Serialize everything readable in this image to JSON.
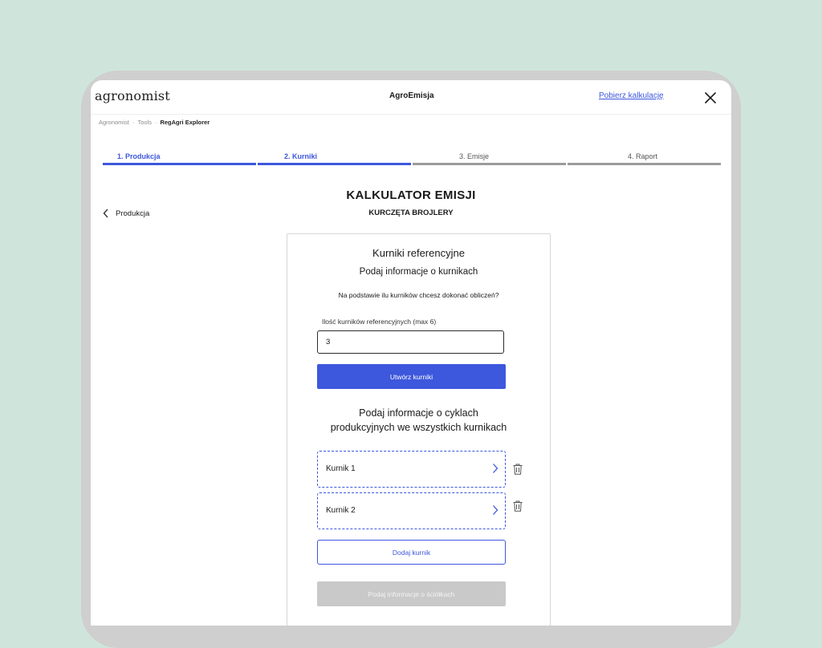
{
  "header": {
    "logo": "agronomist",
    "app_title": "AgroEmisja",
    "download_link": "Pobierz kalkulację"
  },
  "breadcrumb": [
    "Agronomist",
    "Tools",
    "RegAgri Explorer"
  ],
  "steps": [
    {
      "label": "1. Produkcja",
      "status": "done"
    },
    {
      "label": "2. Kurniki",
      "status": "active"
    },
    {
      "label": "3. Emisje",
      "status": "todo"
    },
    {
      "label": "4. Raport",
      "status": "todo"
    }
  ],
  "back_link": "Produkcja",
  "page": {
    "title": "KALKULATOR EMISJI",
    "subtitle": "KURCZĘTA BROJLERY"
  },
  "card": {
    "title": "Kurniki referencyjne",
    "subtitle": "Podaj informacje o kurnikach",
    "question": "Na podstawie ilu kurników chcesz dokonać obliczeń?",
    "field_label": "Ilość kurników referencyjnych (max 6)",
    "field_value": "3",
    "create_button": "Utwórz kurniki",
    "cycles_heading_line1": "Podaj informacje o cyklach",
    "cycles_heading_line2": "produkcyjnych we wszystkich kurnikach",
    "kurniki": [
      {
        "name": "Kurnik 1"
      },
      {
        "name": "Kurnik 2"
      }
    ],
    "add_button": "Dodaj kurnik",
    "next_button": "Podaj informacje o ściółkach"
  },
  "colors": {
    "accent": "#3d57dd",
    "background": "#cfe5dc",
    "disabled": "#c9c9c9"
  },
  "icons": [
    "close-icon",
    "chevron-left-icon",
    "chevron-right-icon",
    "trash-icon"
  ]
}
